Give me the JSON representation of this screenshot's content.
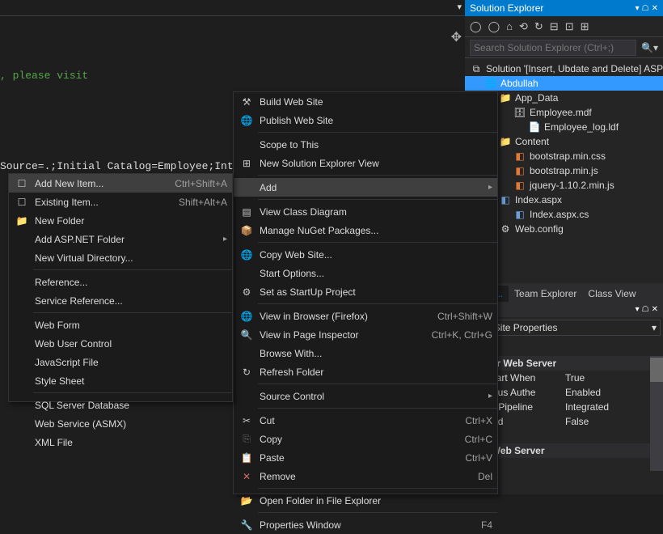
{
  "editor": {
    "line1": ", please visit",
    "line2": "Source=.;Initial Catalog=Employee;Integra"
  },
  "solutionExplorer": {
    "title": "Solution Explorer",
    "searchPlaceholder": "Search Solution Explorer (Ctrl+;)",
    "nodes": {
      "solution": "Solution '[Insert, Ubdate and Delete] ASP",
      "project": "Abdullah",
      "appData": "App_Data",
      "employee": "Employee.mdf",
      "employeeLog": "Employee_log.ldf",
      "content": "Content",
      "bootstrapCss": "bootstrap.min.css",
      "bootstrapJs": "bootstrap.min.js",
      "jquery": "jquery-1.10.2.min.js",
      "indexAspx": "Index.aspx",
      "indexCs": "Index.aspx.cs",
      "webConfig": "Web.config"
    }
  },
  "tabs": {
    "solExplorer": "Explo...",
    "teamExplorer": "Team Explorer",
    "classView": "Class View",
    "props": "s"
  },
  "properties": {
    "title": "Web Site Properties",
    "cat1": "oper Web Server",
    "k1": "s Start When",
    "v1": "True",
    "k2": "ymous Authe",
    "v2": "Enabled",
    "k3": "ged Pipeline",
    "v3": "Integrated",
    "k4": "abled",
    "v4": "False",
    "k5": "RL",
    "v5": "",
    "cat2": "er Web Server"
  },
  "menu1": {
    "build": "Build Web Site",
    "publish": "Publish Web Site",
    "scope": "Scope to This",
    "newView": "New Solution Explorer View",
    "add": "Add",
    "viewClass": "View Class Diagram",
    "nuget": "Manage NuGet Packages...",
    "copySite": "Copy Web Site...",
    "startOpts": "Start Options...",
    "startup": "Set as StartUp Project",
    "viewBrowser": "View in Browser (Firefox)",
    "viewBrowserK": "Ctrl+Shift+W",
    "viewPage": "View in Page Inspector",
    "viewPageK": "Ctrl+K, Ctrl+G",
    "browseWith": "Browse With...",
    "refresh": "Refresh Folder",
    "sourceCtrl": "Source Control",
    "cut": "Cut",
    "cutK": "Ctrl+X",
    "copy": "Copy",
    "copyK": "Ctrl+C",
    "paste": "Paste",
    "pasteK": "Ctrl+V",
    "remove": "Remove",
    "removeK": "Del",
    "openFolder": "Open Folder in File Explorer",
    "propsWin": "Properties Window",
    "propsWinK": "F4"
  },
  "menu2": {
    "addNew": "Add New Item...",
    "addNewK": "Ctrl+Shift+A",
    "existing": "Existing Item...",
    "existingK": "Shift+Alt+A",
    "newFolder": "New Folder",
    "aspFolder": "Add ASP.NET Folder",
    "virtDir": "New Virtual Directory...",
    "reference": "Reference...",
    "serviceRef": "Service Reference...",
    "webForm": "Web Form",
    "webUserCtrl": "Web User Control",
    "jsFile": "JavaScript File",
    "styleSheet": "Style Sheet",
    "sqlDb": "SQL Server Database",
    "webService": "Web Service (ASMX)",
    "xmlFile": "XML File"
  }
}
